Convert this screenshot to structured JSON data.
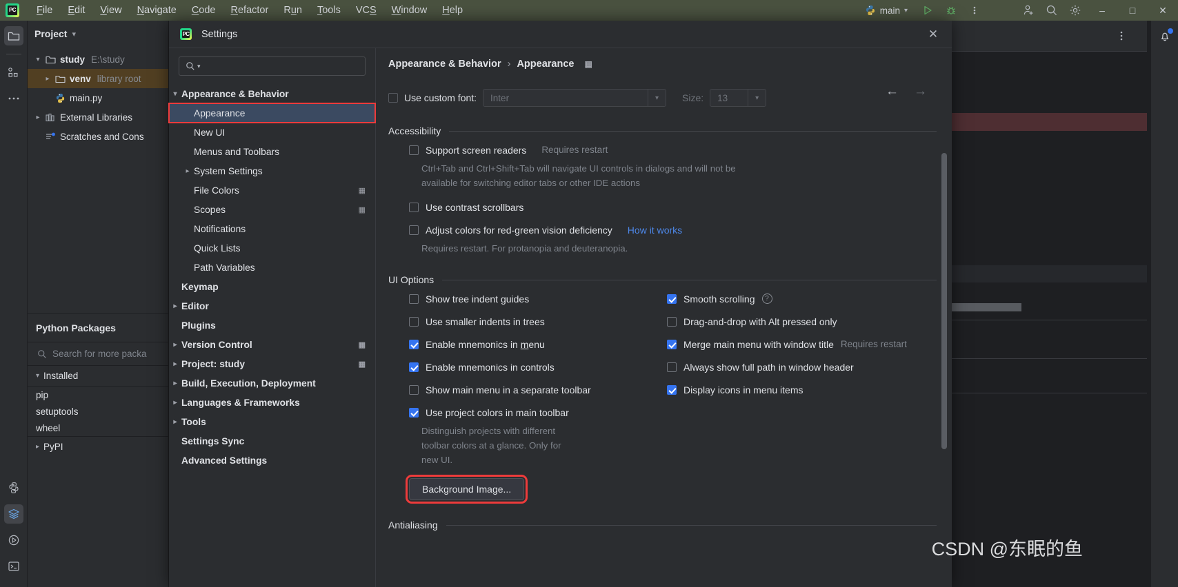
{
  "app": {
    "logo_text": "PC",
    "menu": [
      {
        "name": "file",
        "label": "File",
        "mnemonic": "F"
      },
      {
        "name": "edit",
        "label": "Edit",
        "mnemonic": "E"
      },
      {
        "name": "view",
        "label": "View",
        "mnemonic": "V"
      },
      {
        "name": "navigate",
        "label": "Navigate",
        "mnemonic": "N"
      },
      {
        "name": "code",
        "label": "Code",
        "mnemonic": "C"
      },
      {
        "name": "refactor",
        "label": "Refactor",
        "mnemonic": "R"
      },
      {
        "name": "run",
        "label": "Run",
        "mnemonic": "u"
      },
      {
        "name": "tools",
        "label": "Tools",
        "mnemonic": "T"
      },
      {
        "name": "vcs",
        "label": "VCS",
        "mnemonic": "S"
      },
      {
        "name": "window",
        "label": "Window",
        "mnemonic": "W"
      },
      {
        "name": "help",
        "label": "Help",
        "mnemonic": "H"
      }
    ],
    "run_config": "main",
    "titlebar_color": "#4a5240"
  },
  "project": {
    "panel_title": "Project",
    "tree": [
      {
        "label": "study",
        "detail": "E:\\study",
        "arrow": "down",
        "icon": "folder-icon",
        "indent": 0,
        "selected": false
      },
      {
        "label": "venv",
        "detail": "library root",
        "arrow": "right",
        "icon": "folder-icon",
        "indent": 1,
        "selected": true
      },
      {
        "label": "main.py",
        "detail": "",
        "arrow": "",
        "icon": "python-file-icon",
        "indent": 2,
        "selected": false
      },
      {
        "label": "External Libraries",
        "detail": "",
        "arrow": "right",
        "icon": "library-icon",
        "indent": 0,
        "selected": false
      },
      {
        "label": "Scratches and Cons",
        "detail": "",
        "arrow": "",
        "icon": "scratches-icon",
        "indent": 0,
        "selected": false
      }
    ]
  },
  "packages": {
    "title": "Python Packages",
    "search_placeholder": "Search for more packa",
    "installed_label": "Installed",
    "items": [
      "pip",
      "setuptools",
      "wheel"
    ],
    "repo_label": "PyPI"
  },
  "dialog": {
    "title": "Settings",
    "search_value": "",
    "search_placeholder": "",
    "nav": [
      {
        "label": "Appearance & Behavior",
        "indent": 0,
        "arrow": "down",
        "bold": true,
        "selected": false,
        "gear": false,
        "highlight": false
      },
      {
        "label": "Appearance",
        "indent": 1,
        "arrow": "",
        "bold": false,
        "selected": true,
        "gear": false,
        "highlight": true
      },
      {
        "label": "New UI",
        "indent": 1,
        "arrow": "",
        "bold": false,
        "selected": false,
        "gear": false,
        "highlight": false
      },
      {
        "label": "Menus and Toolbars",
        "indent": 1,
        "arrow": "",
        "bold": false,
        "selected": false,
        "gear": false,
        "highlight": false
      },
      {
        "label": "System Settings",
        "indent": 1,
        "arrow": "right",
        "bold": false,
        "selected": false,
        "gear": false,
        "highlight": false
      },
      {
        "label": "File Colors",
        "indent": 1,
        "arrow": "",
        "bold": false,
        "selected": false,
        "gear": true,
        "highlight": false
      },
      {
        "label": "Scopes",
        "indent": 1,
        "arrow": "",
        "bold": false,
        "selected": false,
        "gear": true,
        "highlight": false
      },
      {
        "label": "Notifications",
        "indent": 1,
        "arrow": "",
        "bold": false,
        "selected": false,
        "gear": false,
        "highlight": false
      },
      {
        "label": "Quick Lists",
        "indent": 1,
        "arrow": "",
        "bold": false,
        "selected": false,
        "gear": false,
        "highlight": false
      },
      {
        "label": "Path Variables",
        "indent": 1,
        "arrow": "",
        "bold": false,
        "selected": false,
        "gear": false,
        "highlight": false
      },
      {
        "label": "Keymap",
        "indent": 0,
        "arrow": "",
        "bold": true,
        "selected": false,
        "gear": false,
        "highlight": false
      },
      {
        "label": "Editor",
        "indent": 0,
        "arrow": "right",
        "bold": true,
        "selected": false,
        "gear": false,
        "highlight": false
      },
      {
        "label": "Plugins",
        "indent": 0,
        "arrow": "",
        "bold": true,
        "selected": false,
        "gear": false,
        "highlight": false
      },
      {
        "label": "Version Control",
        "indent": 0,
        "arrow": "right",
        "bold": true,
        "selected": false,
        "gear": true,
        "highlight": false
      },
      {
        "label": "Project: study",
        "indent": 0,
        "arrow": "right",
        "bold": true,
        "selected": false,
        "gear": true,
        "highlight": false
      },
      {
        "label": "Build, Execution, Deployment",
        "indent": 0,
        "arrow": "right",
        "bold": true,
        "selected": false,
        "gear": false,
        "highlight": false
      },
      {
        "label": "Languages & Frameworks",
        "indent": 0,
        "arrow": "right",
        "bold": true,
        "selected": false,
        "gear": false,
        "highlight": false
      },
      {
        "label": "Tools",
        "indent": 0,
        "arrow": "right",
        "bold": true,
        "selected": false,
        "gear": false,
        "highlight": false
      },
      {
        "label": "Settings Sync",
        "indent": 0,
        "arrow": "",
        "bold": true,
        "selected": false,
        "gear": false,
        "highlight": false
      },
      {
        "label": "Advanced Settings",
        "indent": 0,
        "arrow": "",
        "bold": true,
        "selected": false,
        "gear": false,
        "highlight": false
      }
    ],
    "breadcrumb": {
      "root": "Appearance & Behavior",
      "separator": "›",
      "leaf": "Appearance"
    },
    "font": {
      "checkbox_label": "Use custom font:",
      "checked": false,
      "font_value": "Inter",
      "size_label": "Size:",
      "size_value": "13"
    },
    "accessibility": {
      "heading": "Accessibility",
      "screen_readers": {
        "label": "Support screen readers",
        "note": "Requires restart",
        "checked": false
      },
      "screen_readers_desc_line1": "Ctrl+Tab and Ctrl+Shift+Tab will navigate UI controls in dialogs and will not be",
      "screen_readers_desc_line2": "available for switching editor tabs or other IDE actions",
      "contrast_scrollbars": {
        "label": "Use contrast scrollbars",
        "checked": false
      },
      "red_green": {
        "label": "Adjust colors for red-green vision deficiency",
        "checked": false,
        "link": "How it works"
      },
      "red_green_desc": "Requires restart. For protanopia and deuteranopia."
    },
    "ui_options": {
      "heading": "UI Options",
      "left": [
        {
          "label": "Show tree indent guides",
          "checked": false,
          "mnemonic": ""
        },
        {
          "label": "Use smaller indents in trees",
          "checked": false,
          "mnemonic": ""
        },
        {
          "label": "Enable mnemonics in menu",
          "checked": true,
          "mnemonic": "m"
        },
        {
          "label": "Enable mnemonics in controls",
          "checked": true,
          "mnemonic": ""
        },
        {
          "label": "Show main menu in a separate toolbar",
          "checked": false,
          "mnemonic": ""
        },
        {
          "label": "Use project colors in main toolbar",
          "checked": true,
          "mnemonic": ""
        }
      ],
      "left_desc_line1": "Distinguish projects with different",
      "left_desc_line2": "toolbar colors at a glance. Only for",
      "left_desc_line3": "new UI.",
      "right": [
        {
          "label": "Smooth scrolling",
          "checked": true,
          "note": "",
          "help": true
        },
        {
          "label": "Drag-and-drop with Alt pressed only",
          "checked": false,
          "note": "",
          "help": false
        },
        {
          "label": "Merge main menu with window title",
          "checked": true,
          "note": "Requires restart",
          "help": false
        },
        {
          "label": "Always show full path in window header",
          "checked": false,
          "note": "",
          "help": false
        },
        {
          "label": "Display icons in menu items",
          "checked": true,
          "note": "",
          "help": false
        }
      ]
    },
    "background_image_button": "Background Image...",
    "antialiasing_heading": "Antialiasing"
  },
  "watermark": "CSDN @东眠的鱼",
  "colors": {
    "accent": "#3574f0",
    "highlight_red": "#ee3b3b",
    "selection": "#3b4a61",
    "link": "#4d87e8",
    "titlebar": "#4a5240"
  }
}
